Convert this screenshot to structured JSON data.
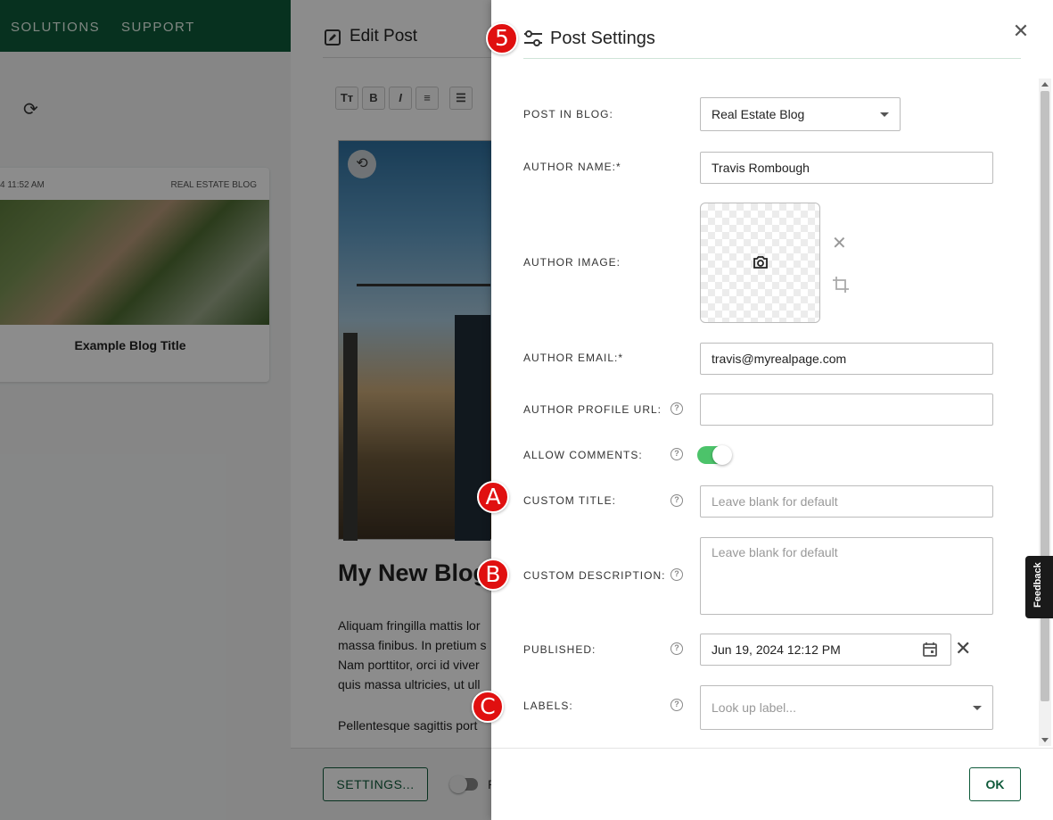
{
  "background": {
    "nav": [
      "SOLUTIONS",
      "SUPPORT"
    ],
    "card": {
      "date": "4 11:52 AM",
      "blog": "REAL ESTATE BLOG",
      "title": "Example Blog Title"
    },
    "editor": {
      "title": "Edit Post",
      "format_buttons": [
        "Tт",
        "B",
        "I",
        "≡",
        "☰"
      ],
      "post_title": "My New Blog",
      "body_lines": [
        "Aliquam fringilla mattis lor",
        "massa finibus. In pretium s",
        "Nam porttitor, orci id viver",
        "quis massa ultricies, ut ull"
      ],
      "body_line2": "Pellentesque sagittis port",
      "settings_button": "SETTINGS...",
      "toggle_label": "P"
    }
  },
  "drawer": {
    "title": "Post Settings",
    "fields": {
      "post_in_blog": {
        "label": "POST IN BLOG:",
        "value": "Real Estate Blog"
      },
      "author_name": {
        "label": "AUTHOR NAME:*",
        "value": "Travis Rombough"
      },
      "author_image": {
        "label": "AUTHOR IMAGE:"
      },
      "author_email": {
        "label": "AUTHOR EMAIL:*",
        "value": "travis@myrealpage.com"
      },
      "author_profile_url": {
        "label": "AUTHOR PROFILE URL:",
        "value": ""
      },
      "allow_comments": {
        "label": "ALLOW COMMENTS:",
        "enabled": true
      },
      "custom_title": {
        "label": "CUSTOM TITLE:",
        "placeholder": "Leave blank for default"
      },
      "custom_description": {
        "label": "CUSTOM DESCRIPTION:",
        "placeholder": "Leave blank for default"
      },
      "published": {
        "label": "PUBLISHED:",
        "value": "Jun 19, 2024 12:12 PM"
      },
      "labels": {
        "label": "LABELS:",
        "placeholder": "Look up label..."
      }
    },
    "ok_button": "OK"
  },
  "feedback": "Feedback",
  "annotations": [
    "5",
    "A",
    "B",
    "C"
  ],
  "colors": {
    "brand_green": "#0e5a3a",
    "toggle_on": "#4cc36a",
    "badge_red": "#e01010"
  }
}
